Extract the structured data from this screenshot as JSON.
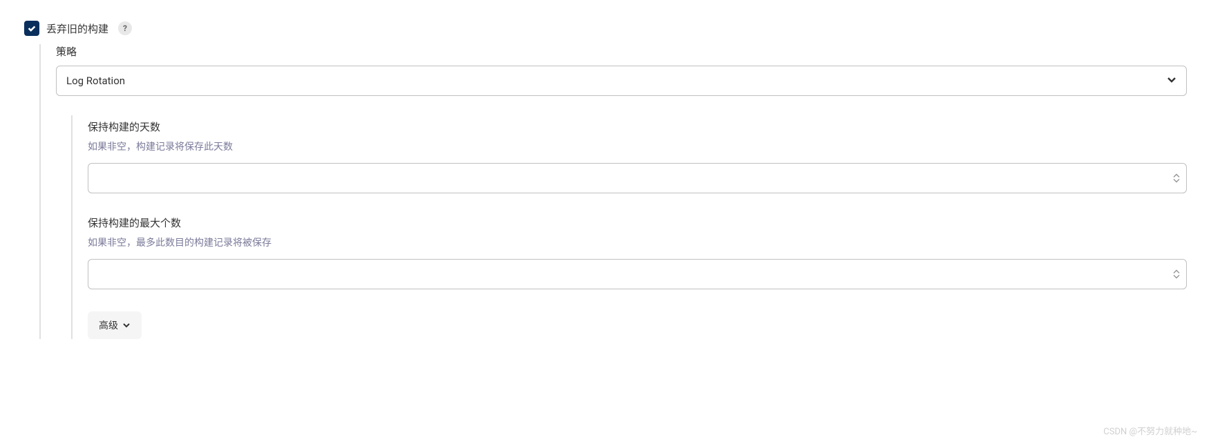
{
  "discard": {
    "checkbox_label": "丢弃旧的构建",
    "help_tooltip": "?"
  },
  "strategy": {
    "label": "策略",
    "selected": "Log Rotation"
  },
  "fields": {
    "days_to_keep": {
      "label": "保持构建的天数",
      "hint": "如果非空，构建记录将保存此天数",
      "value": ""
    },
    "max_to_keep": {
      "label": "保持构建的最大个数",
      "hint": "如果非空，最多此数目的构建记录将被保存",
      "value": ""
    }
  },
  "advanced_button": "高级",
  "watermark": "CSDN @不努力就种地~"
}
